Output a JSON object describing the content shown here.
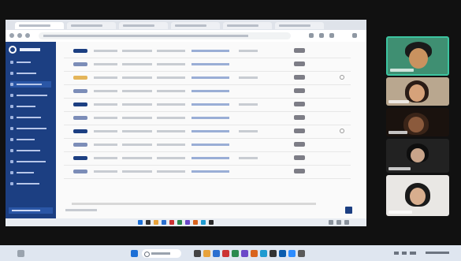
{
  "browser": {
    "tabs": [
      {
        "label": "",
        "active": true
      },
      {
        "label": "",
        "active": false
      },
      {
        "label": "",
        "active": false
      },
      {
        "label": "",
        "active": false
      },
      {
        "label": "",
        "active": false
      },
      {
        "label": "",
        "active": false
      }
    ],
    "url": ""
  },
  "sidebar": {
    "brand": "",
    "items": [
      {
        "label": ""
      },
      {
        "label": ""
      },
      {
        "label": ""
      },
      {
        "label": ""
      },
      {
        "label": ""
      },
      {
        "label": ""
      },
      {
        "label": ""
      },
      {
        "label": ""
      },
      {
        "label": ""
      },
      {
        "label": ""
      },
      {
        "label": ""
      },
      {
        "label": ""
      }
    ],
    "footer": ""
  },
  "main": {
    "rows": [
      {
        "chip_color": "#1c3f82",
        "status": "",
        "selected": false
      },
      {
        "chip_color": "#7c8db8",
        "status": "",
        "selected": false
      },
      {
        "chip_color": "#e4b55a",
        "status": "",
        "selected": true
      },
      {
        "chip_color": "#7c8db8",
        "status": "",
        "selected": false
      },
      {
        "chip_color": "#1c3f82",
        "status": "",
        "selected": false
      },
      {
        "chip_color": "#7c8db8",
        "status": "",
        "selected": false
      },
      {
        "chip_color": "#1c3f82",
        "status": "",
        "selected": true
      },
      {
        "chip_color": "#7c8db8",
        "status": "",
        "selected": false
      },
      {
        "chip_color": "#1c3f82",
        "status": "",
        "selected": false
      },
      {
        "chip_color": "#7c8db8",
        "status": "",
        "selected": false
      }
    ],
    "pager": {
      "text": "",
      "current_page": ""
    }
  },
  "participants": [
    {
      "name": "",
      "active_speaker": true
    },
    {
      "name": "",
      "active_speaker": false
    },
    {
      "name": "",
      "active_speaker": false
    },
    {
      "name": "",
      "active_speaker": false
    },
    {
      "name": "",
      "active_speaker": false
    }
  ],
  "colors": {
    "accent": "#1c3f82",
    "speaker_border": "#3cc4a0",
    "chip_orange": "#e4b55a"
  },
  "icons": [
    "search-icon",
    "start-icon",
    "close-icon",
    "more-icon"
  ]
}
